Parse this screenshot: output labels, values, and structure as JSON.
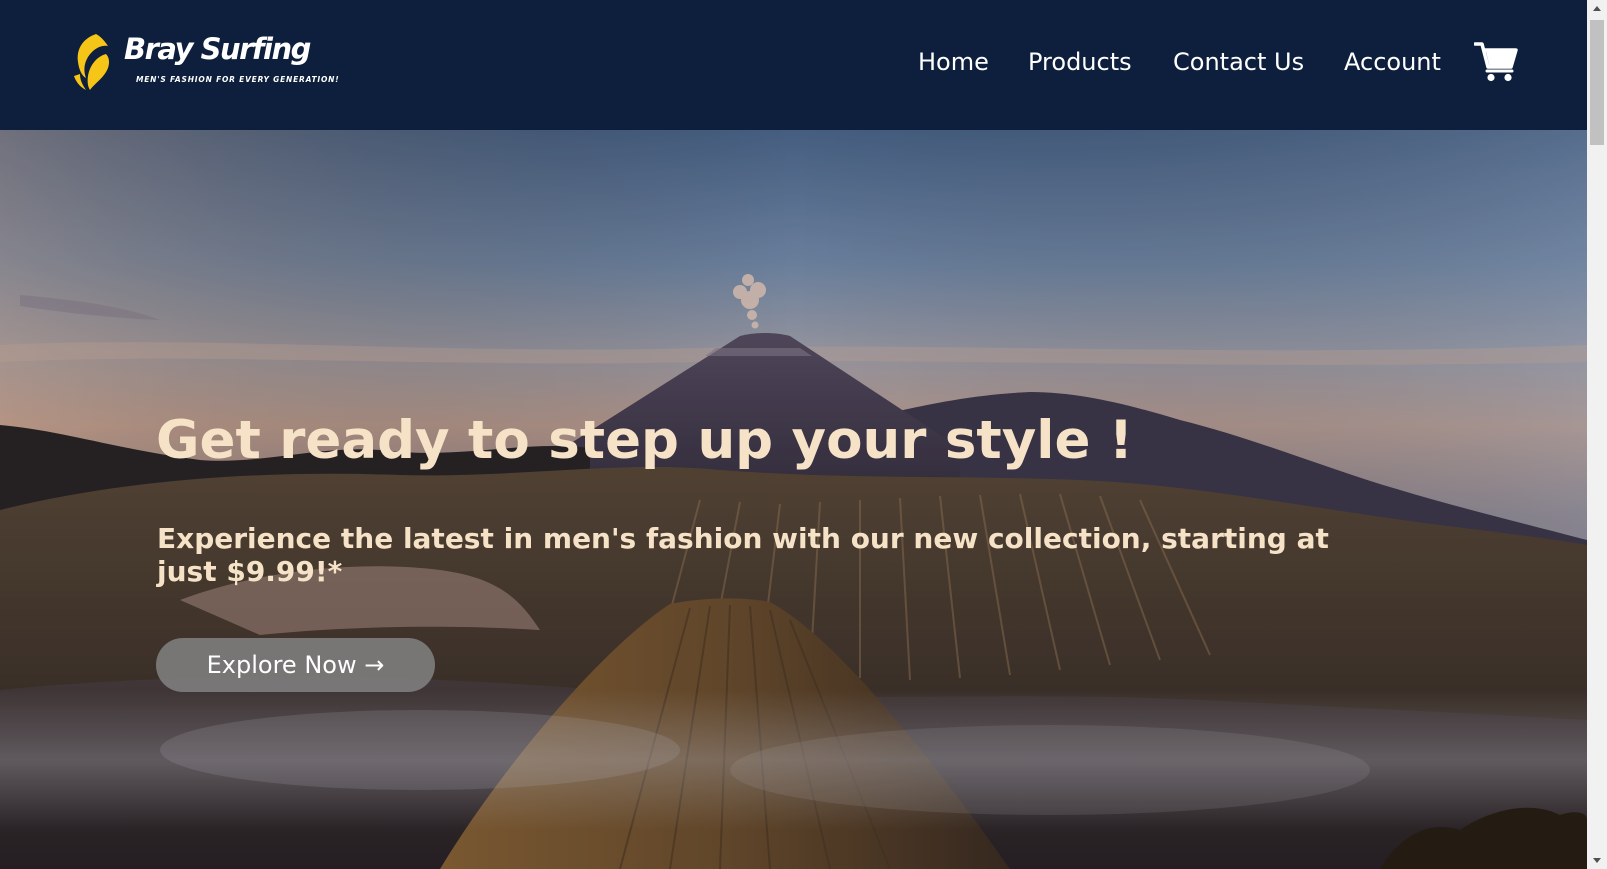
{
  "header": {
    "brand_name": "Bray Surfing",
    "tagline": "MEN'S FASHION FOR EVERY GENERATION!",
    "logo_color": "#f5c518",
    "background": "#0d1f3c"
  },
  "nav": {
    "items": [
      "Home",
      "Products",
      "Contact Us",
      "Account"
    ],
    "cart_icon": "shopping-cart-icon"
  },
  "hero": {
    "title": "Get ready to step up your style !",
    "subtitle": "Experience the latest in men's fashion with our new collection, starting at just $9.99!*",
    "cta_label": "Explore Now →",
    "text_color": "#f6e3c7",
    "background_image": "volcanic-mountain-landscape-at-dawn"
  },
  "scrollbar": {
    "up_icon": "scroll-up-arrow-icon",
    "down_icon": "scroll-down-arrow-icon"
  }
}
